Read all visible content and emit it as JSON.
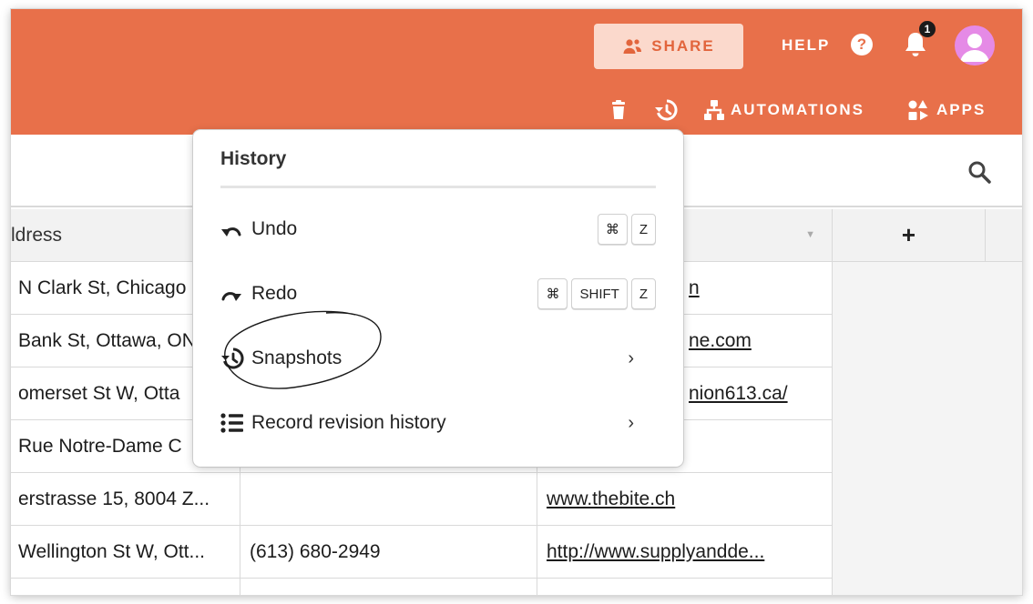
{
  "header": {
    "share_label": "SHARE",
    "help_label": "HELP",
    "help_icon_glyph": "?",
    "notification_count": "1",
    "accent_color": "#e8704a"
  },
  "toolbar": {
    "automations_label": "AUTOMATIONS",
    "apps_label": "APPS"
  },
  "grid": {
    "columns": [
      {
        "label": "ldress"
      },
      {
        "label": ""
      },
      {
        "label": ""
      },
      {
        "label": "+"
      }
    ],
    "rows": [
      {
        "address": "N Clark St, Chicago",
        "phone": "",
        "web": "n"
      },
      {
        "address": "Bank St, Ottawa, ON",
        "phone": "",
        "web": "ne.com"
      },
      {
        "address": "omerset St W, Otta",
        "phone": "",
        "web": "nion613.ca/"
      },
      {
        "address": "Rue Notre-Dame C",
        "phone": "",
        "web": ""
      },
      {
        "address": "erstrasse 15, 8004 Z...",
        "phone": "",
        "web": "www.thebite.ch"
      },
      {
        "address": "Wellington St W, Ott...",
        "phone": "(613) 680-2949",
        "web": "http://www.supplyandde..."
      }
    ]
  },
  "history_menu": {
    "title": "History",
    "items": [
      {
        "label": "Undo",
        "keys": [
          "⌘",
          "Z"
        ]
      },
      {
        "label": "Redo",
        "keys": [
          "⌘",
          "SHIFT",
          "Z"
        ]
      },
      {
        "label": "Snapshots",
        "chevron": "›"
      },
      {
        "label": "Record revision history",
        "chevron": "›"
      }
    ]
  },
  "icons": {
    "share": "share-users-icon",
    "bell": "bell-icon",
    "avatar": "user-avatar-icon",
    "trash": "trash-icon",
    "history": "history-icon",
    "automations": "automations-icon",
    "apps": "apps-icon",
    "search": "search-icon"
  }
}
